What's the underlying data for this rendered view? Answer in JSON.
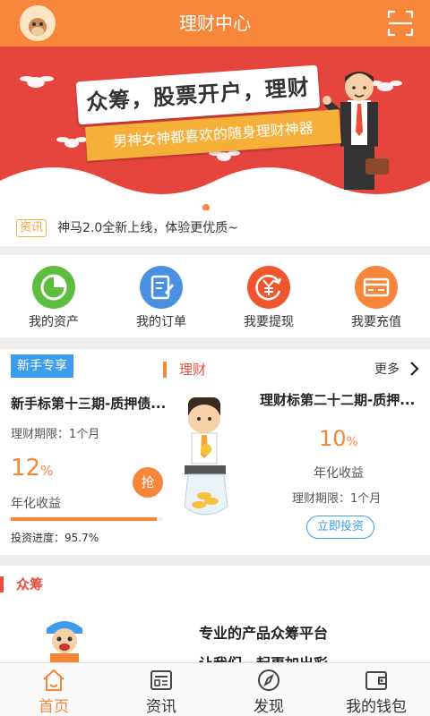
{
  "header": {
    "title": "理财中心",
    "avatar_icon": "cow-avatar-icon",
    "scan_icon": "scan-icon"
  },
  "banner": {
    "title": "众筹，股票开户，理财",
    "subtitle": "男神女神都喜欢的随身理财神器",
    "slides": 3,
    "active_slide": 0
  },
  "news": {
    "tag": "资讯",
    "text": "神马2.0全新上线，体验更优质~"
  },
  "quick_menu": [
    {
      "label": "我的资产",
      "icon": "pie-chart-icon",
      "color": "#5cbd3f"
    },
    {
      "label": "我的订单",
      "icon": "order-edit-icon",
      "color": "#4a90e2"
    },
    {
      "label": "我要提现",
      "icon": "yuan-withdraw-icon",
      "color": "#f0562e"
    },
    {
      "label": "我要充值",
      "icon": "card-recharge-icon",
      "color": "#f7853a"
    }
  ],
  "invest": {
    "newbie_tag": "新手专享",
    "section_title": "理财",
    "more_label": "更多",
    "product1": {
      "name": "新手标第十三期-质押债...",
      "term": "理财期限：1个月",
      "rate_num": "12",
      "rate_pct": "%",
      "rate_label": "年化收益",
      "grab_label": "抢",
      "progress_text": "投资进度：95.7%",
      "progress": 0.957
    },
    "product2": {
      "name": "理财标第二十二期-质押...",
      "rate_num": "10",
      "rate_pct": "%",
      "rate_label": "年化收益",
      "term": "理财期限：1个月",
      "button": "立即投资"
    }
  },
  "crowd": {
    "title": "众筹",
    "line1": "专业的产品众筹平台",
    "line2": "让我们一起更加出彩"
  },
  "bottom_nav": [
    {
      "label": "首页",
      "icon": "home-icon",
      "active": true
    },
    {
      "label": "资讯",
      "icon": "news-icon",
      "active": false
    },
    {
      "label": "发现",
      "icon": "compass-icon",
      "active": false
    },
    {
      "label": "我的钱包",
      "icon": "wallet-icon",
      "active": false
    }
  ],
  "colors": {
    "accent": "#f7853a",
    "banner_bg": "#e6453e",
    "blue": "#3d9ded",
    "red": "#e84c3d"
  }
}
